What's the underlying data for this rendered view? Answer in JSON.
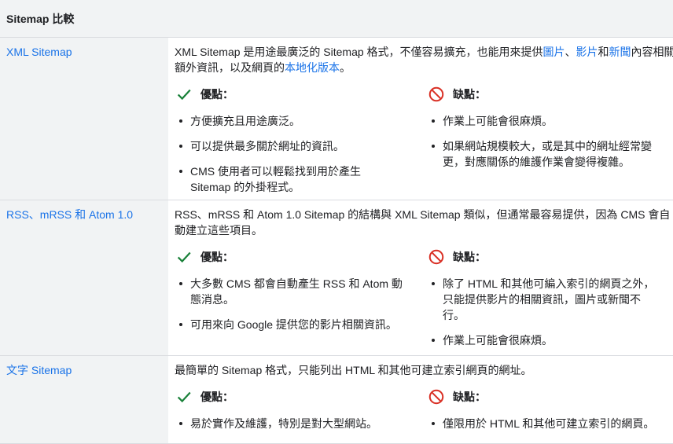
{
  "header": {
    "title": "Sitemap 比較"
  },
  "rows": [
    {
      "label": "XML Sitemap",
      "desc_parts": [
        "XML Sitemap 是用途最廣泛的 Sitemap 格式，不僅容易擴充，也能用來提供",
        "圖片",
        "、",
        "影片",
        "和",
        "新聞",
        "內容相關額外資訊，以及網頁的",
        "本地化版本",
        "。"
      ],
      "pros_title": "優點：",
      "cons_title": "缺點：",
      "pros": [
        "方便擴充且用途廣泛。",
        "可以提供最多關於網址的資訊。",
        "CMS 使用者可以輕鬆找到用於產生 Sitemap 的外掛程式。"
      ],
      "cons": [
        "作業上可能會很麻煩。",
        "如果網站規模較大，或是其中的網址經常變更，對應關係的維護作業會變得複雜。"
      ]
    },
    {
      "label": "RSS、mRSS 和 Atom 1.0",
      "desc": "RSS、mRSS 和 Atom 1.0 Sitemap 的結構與 XML Sitemap 類似，但通常最容易提供，因為 CMS 會自動建立這些項目。",
      "pros_title": "優點：",
      "cons_title": "缺點：",
      "pros": [
        "大多數 CMS 都會自動產生 RSS 和 Atom 動態消息。",
        "可用來向 Google 提供您的影片相關資訊。"
      ],
      "cons": [
        "除了 HTML 和其他可編入索引的網頁之外，只能提供影片的相關資訊，圖片或新聞不行。",
        "作業上可能會很麻煩。"
      ]
    },
    {
      "label": "文字 Sitemap",
      "desc": "最簡單的 Sitemap 格式，只能列出 HTML 和其他可建立索引網頁的網址。",
      "pros_title": "優點：",
      "cons_title": "缺點：",
      "pros": [
        "易於實作及維護，特別是對大型網站。"
      ],
      "cons": [
        "僅限用於 HTML 和其他可建立索引的網頁。"
      ]
    }
  ],
  "colors": {
    "link": "#1a73e8",
    "check": "#188038",
    "no": "#d93025",
    "label_bg": "#f1f3f4"
  },
  "icons": {
    "pros": "check-icon",
    "cons": "no-entry-icon"
  }
}
